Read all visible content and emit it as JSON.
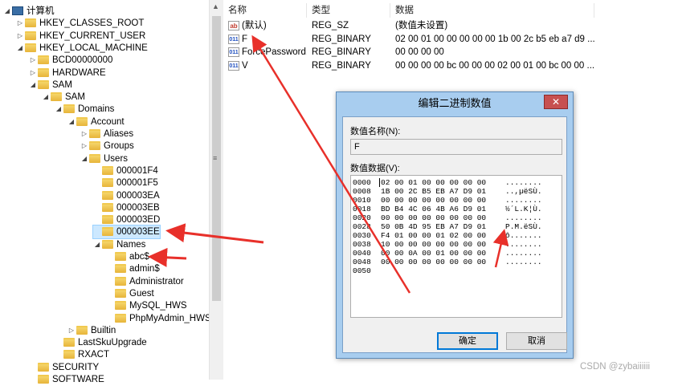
{
  "tree": [
    {
      "label": "计算机",
      "level": 0,
      "exp": "◢",
      "icon": "computer-icon",
      "slug": "computer"
    },
    {
      "label": "HKEY_CLASSES_ROOT",
      "level": 1,
      "exp": "▷",
      "icon": "folder-icon",
      "slug": "hkcr"
    },
    {
      "label": "HKEY_CURRENT_USER",
      "level": 1,
      "exp": "▷",
      "icon": "folder-icon",
      "slug": "hkcu"
    },
    {
      "label": "HKEY_LOCAL_MACHINE",
      "level": 1,
      "exp": "◢",
      "icon": "folder-icon",
      "slug": "hklm"
    },
    {
      "label": "BCD00000000",
      "level": 2,
      "exp": "▷",
      "icon": "folder-icon",
      "slug": "bcd"
    },
    {
      "label": "HARDWARE",
      "level": 2,
      "exp": "▷",
      "icon": "folder-icon",
      "slug": "hardware"
    },
    {
      "label": "SAM",
      "level": 2,
      "exp": "◢",
      "icon": "folder-icon",
      "slug": "sam"
    },
    {
      "label": "SAM",
      "level": 3,
      "exp": "◢",
      "icon": "folder-icon",
      "slug": "sam-sam"
    },
    {
      "label": "Domains",
      "level": 4,
      "exp": "◢",
      "icon": "folder-icon",
      "slug": "domains"
    },
    {
      "label": "Account",
      "level": 5,
      "exp": "◢",
      "icon": "folder-icon",
      "slug": "account"
    },
    {
      "label": "Aliases",
      "level": 6,
      "exp": "▷",
      "icon": "folder-icon",
      "slug": "aliases"
    },
    {
      "label": "Groups",
      "level": 6,
      "exp": "▷",
      "icon": "folder-icon",
      "slug": "groups"
    },
    {
      "label": "Users",
      "level": 6,
      "exp": "◢",
      "icon": "folder-icon",
      "slug": "users"
    },
    {
      "label": "000001F4",
      "level": 7,
      "exp": "",
      "icon": "folder-icon",
      "slug": "000001f4"
    },
    {
      "label": "000001F5",
      "level": 7,
      "exp": "",
      "icon": "folder-icon",
      "slug": "000001f5"
    },
    {
      "label": "000003EA",
      "level": 7,
      "exp": "",
      "icon": "folder-icon",
      "slug": "000003ea"
    },
    {
      "label": "000003EB",
      "level": 7,
      "exp": "",
      "icon": "folder-icon",
      "slug": "000003eb"
    },
    {
      "label": "000003ED",
      "level": 7,
      "exp": "",
      "icon": "folder-icon",
      "slug": "000003ed"
    },
    {
      "label": "000003EE",
      "level": 7,
      "exp": "",
      "icon": "folder-icon",
      "slug": "000003ee",
      "selected": true
    },
    {
      "label": "Names",
      "level": 7,
      "exp": "◢",
      "icon": "folder-icon",
      "slug": "names"
    },
    {
      "label": "abc$",
      "level": 8,
      "exp": "",
      "icon": "folder-icon",
      "slug": "abc"
    },
    {
      "label": "admin$",
      "level": 8,
      "exp": "",
      "icon": "folder-icon",
      "slug": "admin"
    },
    {
      "label": "Administrator",
      "level": 8,
      "exp": "",
      "icon": "folder-icon",
      "slug": "administrator"
    },
    {
      "label": "Guest",
      "level": 8,
      "exp": "",
      "icon": "folder-icon",
      "slug": "guest"
    },
    {
      "label": "MySQL_HWS",
      "level": 8,
      "exp": "",
      "icon": "folder-icon",
      "slug": "mysql-hws"
    },
    {
      "label": "PhpMyAdmin_HWS",
      "level": 8,
      "exp": "",
      "icon": "folder-icon",
      "slug": "phpmyadmin-hws"
    },
    {
      "label": "Builtin",
      "level": 5,
      "exp": "▷",
      "icon": "folder-icon",
      "slug": "builtin"
    },
    {
      "label": "LastSkuUpgrade",
      "level": 4,
      "exp": "",
      "icon": "folder-icon",
      "slug": "lastskuupgrade"
    },
    {
      "label": "RXACT",
      "level": 4,
      "exp": "",
      "icon": "folder-icon",
      "slug": "rxact"
    },
    {
      "label": "SECURITY",
      "level": 2,
      "exp": "",
      "icon": "folder-icon",
      "slug": "security"
    },
    {
      "label": "SOFTWARE",
      "level": 2,
      "exp": "",
      "icon": "folder-icon",
      "slug": "software"
    }
  ],
  "list": {
    "headers": {
      "name": "名称",
      "type": "类型",
      "data": "数据"
    },
    "rows": [
      {
        "icon": "string-value-icon",
        "icon_text": "ab",
        "name": "(默认)",
        "type": "REG_SZ",
        "data": "(数值未设置)"
      },
      {
        "icon": "binary-value-icon",
        "icon_text": "011",
        "name": "F",
        "type": "REG_BINARY",
        "data": "02 00 01 00 00 00 00 00 1b 00 2c b5 eb a7 d9 ..."
      },
      {
        "icon": "binary-value-icon",
        "icon_text": "011",
        "name": "ForcePassword...",
        "type": "REG_BINARY",
        "data": "00 00 00 00"
      },
      {
        "icon": "binary-value-icon",
        "icon_text": "011",
        "name": "V",
        "type": "REG_BINARY",
        "data": "00 00 00 00 bc 00 00 00 02 00 01 00 bc 00 00 ..."
      }
    ]
  },
  "dialog": {
    "title": "编辑二进制数值",
    "close": "✕",
    "name_label": "数值名称(N):",
    "name_value": "F",
    "data_label": "数值数据(V):",
    "hex": [
      {
        "off": "0000",
        "bytes": "02 00 01 00 00 00 00 00",
        "ascii": "........"
      },
      {
        "off": "0008",
        "bytes": "1B 00 2C B5 EB A7 D9 01",
        "ascii": "..,µëSÙ."
      },
      {
        "off": "0010",
        "bytes": "00 00 00 00 00 00 00 00",
        "ascii": "........"
      },
      {
        "off": "0018",
        "bytes": "BD B4 4C 06 4B A6 D9 01",
        "ascii": "½´L.K¦Ù."
      },
      {
        "off": "0020",
        "bytes": "00 00 00 00 00 00 00 00",
        "ascii": "........"
      },
      {
        "off": "0028",
        "bytes": "50 0B 4D 95 EB A7 D9 01",
        "ascii": "P.M.ëSÙ."
      },
      {
        "off": "0030",
        "bytes": "F4 01 00 00 01 02 00 00",
        "ascii": "ô......."
      },
      {
        "off": "0038",
        "bytes": "10 00 00 00 00 00 00 00",
        "ascii": "........"
      },
      {
        "off": "0040",
        "bytes": "00 00 0A 00 01 00 00 00",
        "ascii": "........"
      },
      {
        "off": "0048",
        "bytes": "00 00 00 00 00 00 00 00",
        "ascii": "........"
      },
      {
        "off": "0050",
        "bytes": "",
        "ascii": ""
      }
    ],
    "ok": "确定",
    "cancel": "取消"
  },
  "watermark": "CSDN @zybaiiiiii",
  "colors": {
    "arrow": "#e8302a",
    "selection": "#cce8ff",
    "dialog_frame": "#a8cdef",
    "close_button": "#c75050"
  }
}
